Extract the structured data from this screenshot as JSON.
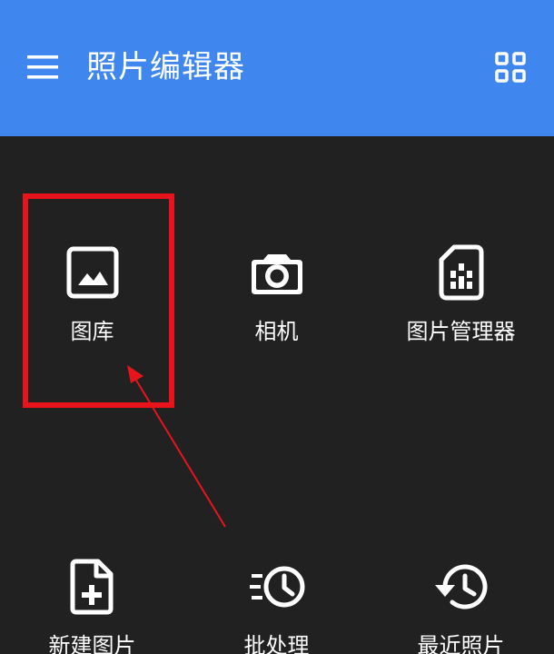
{
  "app_bar": {
    "title": "照片编辑器",
    "menu_icon": "hamburger-menu-icon",
    "grid_icon": "grid-view-icon",
    "color": "#3f87ee"
  },
  "tiles": [
    {
      "label": "图库",
      "icon": "image-gallery-icon"
    },
    {
      "label": "相机",
      "icon": "camera-icon"
    },
    {
      "label": "图片管理器",
      "icon": "sd-card-icon"
    },
    {
      "label": "新建图片",
      "icon": "new-file-icon"
    },
    {
      "label": "批处理",
      "icon": "batch-clock-icon"
    },
    {
      "label": "最近照片",
      "icon": "history-icon"
    }
  ],
  "annotation": {
    "highlight_color": "#e8141c"
  }
}
